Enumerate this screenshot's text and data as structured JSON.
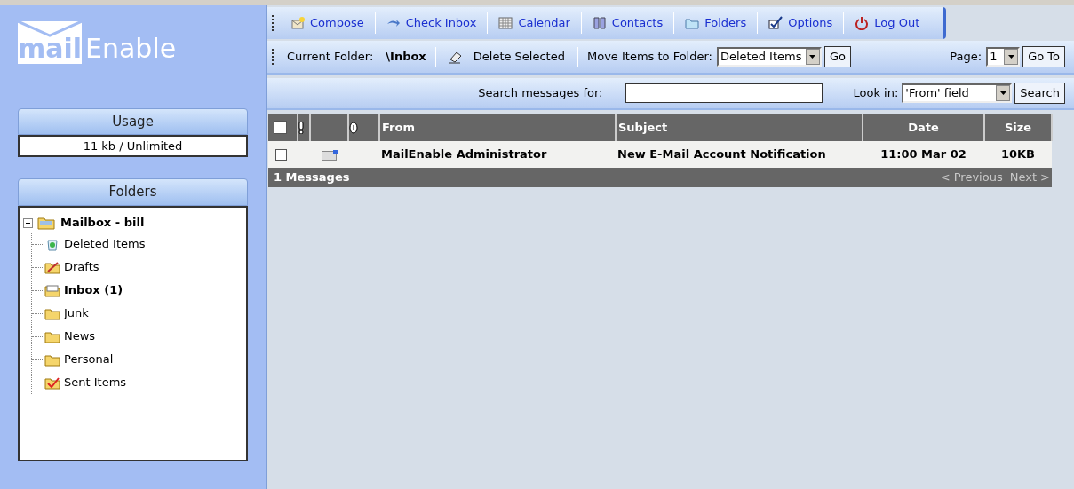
{
  "logo": {
    "word_1": "mail",
    "word_2": "Enable"
  },
  "nav": [
    {
      "label": "Compose"
    },
    {
      "label": "Check Inbox"
    },
    {
      "label": "Calendar"
    },
    {
      "label": "Contacts"
    },
    {
      "label": "Folders"
    },
    {
      "label": "Options"
    },
    {
      "label": "Log Out"
    }
  ],
  "folder_bar": {
    "label": "Current Folder:",
    "folder": "\\Inbox",
    "delete": "Delete Selected",
    "move_label": "Move Items to Folder:",
    "move_select": "Deleted Items",
    "go": "Go",
    "page_label": "Page:",
    "page_select": "1",
    "goto": "Go To"
  },
  "search_bar": {
    "label": "Search messages for:",
    "look_label": "Look in:",
    "look_select": "'From' field",
    "button": "Search"
  },
  "usage": {
    "title": "Usage",
    "value": "11 kb / Unlimited"
  },
  "folders": {
    "title": "Folders",
    "tree": {
      "label": "Mailbox - bill",
      "expanded": true,
      "children": [
        {
          "label": "Deleted Items",
          "kind": "trash",
          "selected": false
        },
        {
          "label": "Drafts",
          "kind": "drafts",
          "selected": false
        },
        {
          "label": "Inbox (1)",
          "kind": "inbox",
          "selected": true
        },
        {
          "label": "Junk",
          "kind": "folder",
          "selected": false
        },
        {
          "label": "News",
          "kind": "folder",
          "selected": false
        },
        {
          "label": "Personal",
          "kind": "folder",
          "selected": false
        },
        {
          "label": "Sent Items",
          "kind": "sent",
          "selected": false
        }
      ]
    }
  },
  "table": {
    "columns": {
      "from": "From",
      "subject": "Subject",
      "date": "Date",
      "size": "Size"
    },
    "select_all": false,
    "rows": [
      {
        "checked": false,
        "from": "MailEnable Administrator",
        "subject": "New E-Mail Account Notification",
        "date": "11:00 Mar 02",
        "size": "10KB"
      }
    ],
    "footer": {
      "count": "1 Messages",
      "previous": "< Previous",
      "next": "Next >",
      "paging_disabled": true
    }
  }
}
